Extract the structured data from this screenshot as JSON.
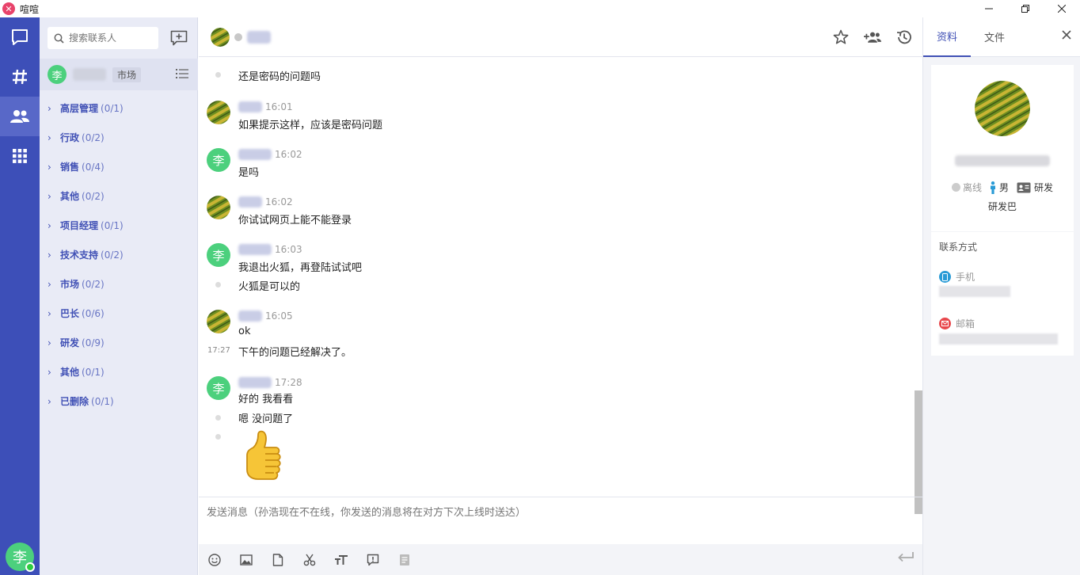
{
  "window": {
    "app_title": "喧喧",
    "logo_glyph": "✕"
  },
  "contacts": {
    "search_placeholder": "搜索联系人",
    "me": {
      "avatar_text": "李",
      "dept": "市场"
    },
    "groups": [
      {
        "name": "高层管理",
        "count": "(0/1)"
      },
      {
        "name": "行政",
        "count": "(0/2)"
      },
      {
        "name": "销售",
        "count": "(0/4)"
      },
      {
        "name": "其他",
        "count": "(0/2)"
      },
      {
        "name": "项目经理",
        "count": "(0/1)"
      },
      {
        "name": "技术支持",
        "count": "(0/2)"
      },
      {
        "name": "市场",
        "count": "(0/2)"
      },
      {
        "name": "巴长",
        "count": "(0/6)"
      },
      {
        "name": "研发",
        "count": "(0/9)"
      },
      {
        "name": "其他",
        "count": "(0/1)"
      },
      {
        "name": "已删除",
        "count": "(0/1)"
      }
    ]
  },
  "nav": {
    "avatar_text": "李"
  },
  "chat": {
    "messages": [
      {
        "text": "还是密码的问题吗"
      },
      {
        "time": "16:01",
        "text": "如果提示这样，应该是密码问题"
      },
      {
        "avatar_text": "李",
        "time": "16:02",
        "text": "是吗"
      },
      {
        "time": "16:02",
        "text": "你试试网页上能不能登录"
      },
      {
        "avatar_text": "李",
        "time": "16:03",
        "text": "我退出火狐，再登陆试试吧"
      },
      {
        "text": "火狐是可以的"
      },
      {
        "time": "16:05",
        "text": "ok"
      },
      {
        "side_time": "17:27",
        "text": "下午的问题已经解决了。"
      },
      {
        "avatar_text": "李",
        "time": "17:28",
        "text": "好的  我看看"
      },
      {
        "text": "嗯  没问题了"
      }
    ],
    "emoji": "👍",
    "composer_placeholder": "发送消息（孙浩现在不在线，你发送的消息将在对方下次上线时送达）"
  },
  "profile": {
    "tabs": [
      "资料",
      "文件"
    ],
    "status": "离线",
    "gender": "男",
    "role": "研发",
    "dept": "研发巴",
    "contact_title": "联系方式",
    "phone_label": "手机",
    "email_label": "邮箱"
  },
  "colors": {
    "nav_bg": "#3d4fb8",
    "accent": "#4050b5",
    "avatar_green": "#4cd07d"
  }
}
